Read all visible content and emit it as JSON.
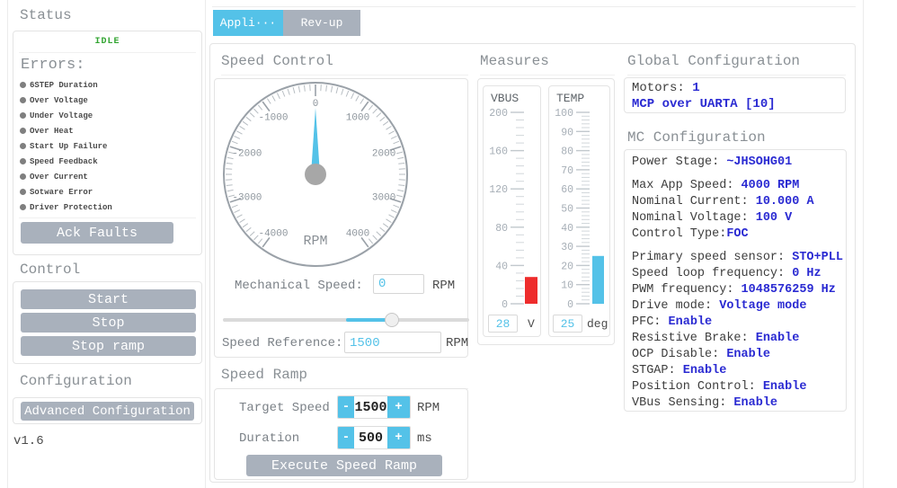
{
  "colors": {
    "accent": "#54c2e8",
    "button_gray": "#a9b1bc",
    "value_blue": "#2a2ad2",
    "status_green": "#33a532",
    "bar_red": "#ee2c2c"
  },
  "sidebar": {
    "status_title": "Status",
    "status_value": "IDLE",
    "errors_title": "Errors:",
    "errors": [
      "6STEP Duration",
      "Over Voltage",
      "Under Voltage",
      "Over Heat",
      "Start Up Failure",
      "Speed Feedback",
      "Over Current",
      "Sotware Error",
      "Driver Protection"
    ],
    "ack_button": "Ack Faults",
    "control_title": "Control",
    "control_buttons": [
      "Start",
      "Stop",
      "Stop ramp"
    ],
    "configuration_title": "Configuration",
    "advanced_button": "Advanced Configuration",
    "version": "v1.6"
  },
  "tabs": {
    "application": "Appli···",
    "revup": "Rev-up"
  },
  "speed_control": {
    "title": "Speed Control",
    "mechanical_speed_label": "Mechanical Speed:",
    "mechanical_speed_value": "0",
    "mechanical_speed_unit": "RPM",
    "speed_reference_label": "Speed Reference:",
    "speed_reference_value": "1500",
    "speed_reference_unit": "RPM",
    "slider": {
      "min": -4000,
      "max": 4000,
      "value": 1500
    }
  },
  "speed_ramp": {
    "title": "Speed Ramp",
    "minus": "-",
    "plus": "+",
    "rows": [
      {
        "label": "Target Speed",
        "value": "1500",
        "unit": "RPM"
      },
      {
        "label": "Duration",
        "value": "500",
        "unit": "ms"
      }
    ],
    "execute_button": "Execute Speed Ramp"
  },
  "measures": {
    "title": "Measures",
    "vbus": {
      "name": "VBUS",
      "value": "28",
      "unit": "V"
    },
    "temp": {
      "name": "TEMP",
      "value": "25",
      "unit": "deg"
    }
  },
  "global_config": {
    "title": "Global Configuration",
    "motors_label": "Motors: ",
    "motors_value": "1",
    "mcp_link": "MCP over UARTA [10]"
  },
  "mc_config": {
    "title": "MC Configuration",
    "groups": [
      [
        {
          "label": "Power Stage: ",
          "value": "~JHSOHG01"
        }
      ],
      [
        {
          "label": "Max App Speed: ",
          "value": "4000 RPM"
        },
        {
          "label": "Nominal Current: ",
          "value": "10.000 A"
        },
        {
          "label": "Nominal Voltage: ",
          "value": "100 V"
        },
        {
          "label": "Control Type:",
          "value": "FOC"
        }
      ],
      [
        {
          "label": "Primary speed sensor: ",
          "value": "STO+PLL"
        },
        {
          "label": "Speed loop frequency: ",
          "value": "0 Hz"
        },
        {
          "label": "PWM frequency: ",
          "value": "1048576259 Hz"
        },
        {
          "label": "Drive mode: ",
          "value": "Voltage mode"
        },
        {
          "label": "PFC: ",
          "value": "Enable"
        },
        {
          "label": "Resistive Brake: ",
          "value": "Enable"
        },
        {
          "label": "OCP Disable: ",
          "value": "Enable"
        },
        {
          "label": "STGAP: ",
          "value": "Enable"
        },
        {
          "label": "Position Control: ",
          "value": "Enable"
        },
        {
          "label": "VBus Sensing: ",
          "value": "Enable"
        }
      ]
    ]
  },
  "chart_data": [
    {
      "type": "dial-gauge",
      "title": "Speed dial",
      "unit": "RPM",
      "min": -4000,
      "max": 4000,
      "major_step": 1000,
      "minor_step": 100,
      "value": 0,
      "labels": [
        -4000,
        -3000,
        -2000,
        -1000,
        0,
        1000,
        2000,
        3000,
        4000
      ]
    },
    {
      "type": "vertical-bar-gauge",
      "title": "VBUS",
      "unit": "V",
      "min": 0,
      "max": 200,
      "major_step": 40,
      "minor_step": 8,
      "value": 28,
      "bar_color": "#ee2c2c",
      "tick_labels": [
        0,
        40,
        80,
        120,
        160,
        200
      ]
    },
    {
      "type": "vertical-bar-gauge",
      "title": "TEMP",
      "unit": "deg",
      "min": 0,
      "max": 100,
      "major_step": 10,
      "minor_step": 2,
      "value": 25,
      "bar_color": "#54c2e8",
      "tick_labels": [
        0,
        10,
        20,
        30,
        40,
        50,
        60,
        70,
        80,
        90,
        100
      ]
    }
  ]
}
